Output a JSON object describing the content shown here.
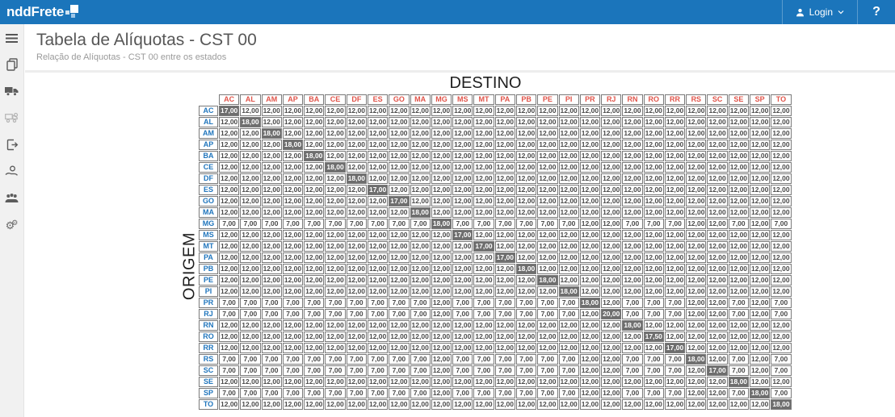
{
  "topbar": {
    "brand": "nddFrete",
    "login_label": "Login",
    "help_label": "?",
    "bg_color": "#1b75bb"
  },
  "sidebar": {
    "items": [
      {
        "icon": "menu-icon"
      },
      {
        "icon": "documents-icon"
      },
      {
        "icon": "truck-icon"
      },
      {
        "icon": "truck-search-icon"
      },
      {
        "icon": "export-icon"
      },
      {
        "icon": "payment-hand-icon"
      },
      {
        "icon": "users-icon"
      },
      {
        "icon": "settings-gears-icon"
      }
    ]
  },
  "page": {
    "title": "Tabela de Alíquotas - CST 00",
    "subtitle": "Relação de Alíquotas - CST 00 entre os estados"
  },
  "matrix": {
    "destino_label": "DESTINO",
    "origem_label": "ORIGEM",
    "diagonal_bg": "#6e6e6e",
    "col_header_color": "#e0544a",
    "row_header_color": "#2176bd",
    "states": [
      "AC",
      "AL",
      "AM",
      "AP",
      "BA",
      "CE",
      "DF",
      "ES",
      "GO",
      "MA",
      "MG",
      "MS",
      "MT",
      "PA",
      "PB",
      "PE",
      "PI",
      "PR",
      "RJ",
      "RN",
      "RO",
      "RR",
      "RS",
      "SC",
      "SE",
      "SP",
      "TO"
    ],
    "rows": [
      {
        "origin": "AC",
        "values": [
          "17,00",
          "12,00",
          "12,00",
          "12,00",
          "12,00",
          "12,00",
          "12,00",
          "12,00",
          "12,00",
          "12,00",
          "12,00",
          "12,00",
          "12,00",
          "12,00",
          "12,00",
          "12,00",
          "12,00",
          "12,00",
          "12,00",
          "12,00",
          "12,00",
          "12,00",
          "12,00",
          "12,00",
          "12,00",
          "12,00",
          "12,00"
        ]
      },
      {
        "origin": "AL",
        "values": [
          "12,00",
          "18,00",
          "12,00",
          "12,00",
          "12,00",
          "12,00",
          "12,00",
          "12,00",
          "12,00",
          "12,00",
          "12,00",
          "12,00",
          "12,00",
          "12,00",
          "12,00",
          "12,00",
          "12,00",
          "12,00",
          "12,00",
          "12,00",
          "12,00",
          "12,00",
          "12,00",
          "12,00",
          "12,00",
          "12,00",
          "12,00"
        ]
      },
      {
        "origin": "AM",
        "values": [
          "12,00",
          "12,00",
          "18,00",
          "12,00",
          "12,00",
          "12,00",
          "12,00",
          "12,00",
          "12,00",
          "12,00",
          "12,00",
          "12,00",
          "12,00",
          "12,00",
          "12,00",
          "12,00",
          "12,00",
          "12,00",
          "12,00",
          "12,00",
          "12,00",
          "12,00",
          "12,00",
          "12,00",
          "12,00",
          "12,00",
          "12,00"
        ]
      },
      {
        "origin": "AP",
        "values": [
          "12,00",
          "12,00",
          "12,00",
          "18,00",
          "12,00",
          "12,00",
          "12,00",
          "12,00",
          "12,00",
          "12,00",
          "12,00",
          "12,00",
          "12,00",
          "12,00",
          "12,00",
          "12,00",
          "12,00",
          "12,00",
          "12,00",
          "12,00",
          "12,00",
          "12,00",
          "12,00",
          "12,00",
          "12,00",
          "12,00",
          "12,00"
        ]
      },
      {
        "origin": "BA",
        "values": [
          "12,00",
          "12,00",
          "12,00",
          "12,00",
          "18,00",
          "12,00",
          "12,00",
          "12,00",
          "12,00",
          "12,00",
          "12,00",
          "12,00",
          "12,00",
          "12,00",
          "12,00",
          "12,00",
          "12,00",
          "12,00",
          "12,00",
          "12,00",
          "12,00",
          "12,00",
          "12,00",
          "12,00",
          "12,00",
          "12,00",
          "12,00"
        ]
      },
      {
        "origin": "CE",
        "values": [
          "12,00",
          "12,00",
          "12,00",
          "12,00",
          "12,00",
          "18,00",
          "12,00",
          "12,00",
          "12,00",
          "12,00",
          "12,00",
          "12,00",
          "12,00",
          "12,00",
          "12,00",
          "12,00",
          "12,00",
          "12,00",
          "12,00",
          "12,00",
          "12,00",
          "12,00",
          "12,00",
          "12,00",
          "12,00",
          "12,00",
          "12,00"
        ]
      },
      {
        "origin": "DF",
        "values": [
          "12,00",
          "12,00",
          "12,00",
          "12,00",
          "12,00",
          "12,00",
          "18,00",
          "12,00",
          "12,00",
          "12,00",
          "12,00",
          "12,00",
          "12,00",
          "12,00",
          "12,00",
          "12,00",
          "12,00",
          "12,00",
          "12,00",
          "12,00",
          "12,00",
          "12,00",
          "12,00",
          "12,00",
          "12,00",
          "12,00",
          "12,00"
        ]
      },
      {
        "origin": "ES",
        "values": [
          "12,00",
          "12,00",
          "12,00",
          "12,00",
          "12,00",
          "12,00",
          "12,00",
          "17,00",
          "12,00",
          "12,00",
          "12,00",
          "12,00",
          "12,00",
          "12,00",
          "12,00",
          "12,00",
          "12,00",
          "12,00",
          "12,00",
          "12,00",
          "12,00",
          "12,00",
          "12,00",
          "12,00",
          "12,00",
          "12,00",
          "12,00"
        ]
      },
      {
        "origin": "GO",
        "values": [
          "12,00",
          "12,00",
          "12,00",
          "12,00",
          "12,00",
          "12,00",
          "12,00",
          "12,00",
          "17,00",
          "12,00",
          "12,00",
          "12,00",
          "12,00",
          "12,00",
          "12,00",
          "12,00",
          "12,00",
          "12,00",
          "12,00",
          "12,00",
          "12,00",
          "12,00",
          "12,00",
          "12,00",
          "12,00",
          "12,00",
          "12,00"
        ]
      },
      {
        "origin": "MA",
        "values": [
          "12,00",
          "12,00",
          "12,00",
          "12,00",
          "12,00",
          "12,00",
          "12,00",
          "12,00",
          "12,00",
          "18,00",
          "12,00",
          "12,00",
          "12,00",
          "12,00",
          "12,00",
          "12,00",
          "12,00",
          "12,00",
          "12,00",
          "12,00",
          "12,00",
          "12,00",
          "12,00",
          "12,00",
          "12,00",
          "12,00",
          "12,00"
        ]
      },
      {
        "origin": "MG",
        "values": [
          "7,00",
          "7,00",
          "7,00",
          "7,00",
          "7,00",
          "7,00",
          "7,00",
          "7,00",
          "7,00",
          "7,00",
          "18,00",
          "7,00",
          "7,00",
          "7,00",
          "7,00",
          "7,00",
          "7,00",
          "12,00",
          "12,00",
          "7,00",
          "7,00",
          "7,00",
          "12,00",
          "12,00",
          "7,00",
          "12,00",
          "7,00"
        ]
      },
      {
        "origin": "MS",
        "values": [
          "12,00",
          "12,00",
          "12,00",
          "12,00",
          "12,00",
          "12,00",
          "12,00",
          "12,00",
          "12,00",
          "12,00",
          "12,00",
          "17,00",
          "12,00",
          "12,00",
          "12,00",
          "12,00",
          "12,00",
          "12,00",
          "12,00",
          "12,00",
          "12,00",
          "12,00",
          "12,00",
          "12,00",
          "12,00",
          "12,00",
          "12,00"
        ]
      },
      {
        "origin": "MT",
        "values": [
          "12,00",
          "12,00",
          "12,00",
          "12,00",
          "12,00",
          "12,00",
          "12,00",
          "12,00",
          "12,00",
          "12,00",
          "12,00",
          "12,00",
          "17,00",
          "12,00",
          "12,00",
          "12,00",
          "12,00",
          "12,00",
          "12,00",
          "12,00",
          "12,00",
          "12,00",
          "12,00",
          "12,00",
          "12,00",
          "12,00",
          "12,00"
        ]
      },
      {
        "origin": "PA",
        "values": [
          "12,00",
          "12,00",
          "12,00",
          "12,00",
          "12,00",
          "12,00",
          "12,00",
          "12,00",
          "12,00",
          "12,00",
          "12,00",
          "12,00",
          "12,00",
          "17,00",
          "12,00",
          "12,00",
          "12,00",
          "12,00",
          "12,00",
          "12,00",
          "12,00",
          "12,00",
          "12,00",
          "12,00",
          "12,00",
          "12,00",
          "12,00"
        ]
      },
      {
        "origin": "PB",
        "values": [
          "12,00",
          "12,00",
          "12,00",
          "12,00",
          "12,00",
          "12,00",
          "12,00",
          "12,00",
          "12,00",
          "12,00",
          "12,00",
          "12,00",
          "12,00",
          "12,00",
          "18,00",
          "12,00",
          "12,00",
          "12,00",
          "12,00",
          "12,00",
          "12,00",
          "12,00",
          "12,00",
          "12,00",
          "12,00",
          "12,00",
          "12,00"
        ]
      },
      {
        "origin": "PE",
        "values": [
          "12,00",
          "12,00",
          "12,00",
          "12,00",
          "12,00",
          "12,00",
          "12,00",
          "12,00",
          "12,00",
          "12,00",
          "12,00",
          "12,00",
          "12,00",
          "12,00",
          "12,00",
          "18,00",
          "12,00",
          "12,00",
          "12,00",
          "12,00",
          "12,00",
          "12,00",
          "12,00",
          "12,00",
          "12,00",
          "12,00",
          "12,00"
        ]
      },
      {
        "origin": "PI",
        "values": [
          "12,00",
          "12,00",
          "12,00",
          "12,00",
          "12,00",
          "12,00",
          "12,00",
          "12,00",
          "12,00",
          "12,00",
          "12,00",
          "12,00",
          "12,00",
          "12,00",
          "12,00",
          "12,00",
          "18,00",
          "12,00",
          "12,00",
          "12,00",
          "12,00",
          "12,00",
          "12,00",
          "12,00",
          "12,00",
          "12,00",
          "12,00"
        ]
      },
      {
        "origin": "PR",
        "values": [
          "7,00",
          "7,00",
          "7,00",
          "7,00",
          "7,00",
          "7,00",
          "7,00",
          "7,00",
          "7,00",
          "7,00",
          "12,00",
          "7,00",
          "7,00",
          "7,00",
          "7,00",
          "7,00",
          "7,00",
          "18,00",
          "12,00",
          "7,00",
          "7,00",
          "7,00",
          "12,00",
          "12,00",
          "7,00",
          "12,00",
          "7,00"
        ]
      },
      {
        "origin": "RJ",
        "values": [
          "7,00",
          "7,00",
          "7,00",
          "7,00",
          "7,00",
          "7,00",
          "7,00",
          "7,00",
          "7,00",
          "7,00",
          "12,00",
          "7,00",
          "7,00",
          "7,00",
          "7,00",
          "7,00",
          "7,00",
          "12,00",
          "20,00",
          "7,00",
          "7,00",
          "7,00",
          "12,00",
          "12,00",
          "7,00",
          "12,00",
          "7,00"
        ]
      },
      {
        "origin": "RN",
        "values": [
          "12,00",
          "12,00",
          "12,00",
          "12,00",
          "12,00",
          "12,00",
          "12,00",
          "12,00",
          "12,00",
          "12,00",
          "12,00",
          "12,00",
          "12,00",
          "12,00",
          "12,00",
          "12,00",
          "12,00",
          "12,00",
          "12,00",
          "18,00",
          "12,00",
          "12,00",
          "12,00",
          "12,00",
          "12,00",
          "12,00",
          "12,00"
        ]
      },
      {
        "origin": "RO",
        "values": [
          "12,00",
          "12,00",
          "12,00",
          "12,00",
          "12,00",
          "12,00",
          "12,00",
          "12,00",
          "12,00",
          "12,00",
          "12,00",
          "12,00",
          "12,00",
          "12,00",
          "12,00",
          "12,00",
          "12,00",
          "12,00",
          "12,00",
          "12,00",
          "17,50",
          "12,00",
          "12,00",
          "12,00",
          "12,00",
          "12,00",
          "12,00"
        ]
      },
      {
        "origin": "RR",
        "values": [
          "12,00",
          "12,00",
          "12,00",
          "12,00",
          "12,00",
          "12,00",
          "12,00",
          "12,00",
          "12,00",
          "12,00",
          "12,00",
          "12,00",
          "12,00",
          "12,00",
          "12,00",
          "12,00",
          "12,00",
          "12,00",
          "12,00",
          "12,00",
          "12,00",
          "17,00",
          "12,00",
          "12,00",
          "12,00",
          "12,00",
          "12,00"
        ]
      },
      {
        "origin": "RS",
        "values": [
          "7,00",
          "7,00",
          "7,00",
          "7,00",
          "7,00",
          "7,00",
          "7,00",
          "7,00",
          "7,00",
          "7,00",
          "12,00",
          "7,00",
          "7,00",
          "7,00",
          "7,00",
          "7,00",
          "7,00",
          "12,00",
          "12,00",
          "7,00",
          "7,00",
          "7,00",
          "18,00",
          "12,00",
          "7,00",
          "12,00",
          "7,00"
        ]
      },
      {
        "origin": "SC",
        "values": [
          "7,00",
          "7,00",
          "7,00",
          "7,00",
          "7,00",
          "7,00",
          "7,00",
          "7,00",
          "7,00",
          "7,00",
          "12,00",
          "7,00",
          "7,00",
          "7,00",
          "7,00",
          "7,00",
          "7,00",
          "12,00",
          "12,00",
          "7,00",
          "7,00",
          "7,00",
          "12,00",
          "17,00",
          "7,00",
          "12,00",
          "7,00"
        ]
      },
      {
        "origin": "SE",
        "values": [
          "12,00",
          "12,00",
          "12,00",
          "12,00",
          "12,00",
          "12,00",
          "12,00",
          "12,00",
          "12,00",
          "12,00",
          "12,00",
          "12,00",
          "12,00",
          "12,00",
          "12,00",
          "12,00",
          "12,00",
          "12,00",
          "12,00",
          "12,00",
          "12,00",
          "12,00",
          "12,00",
          "12,00",
          "18,00",
          "12,00",
          "12,00"
        ]
      },
      {
        "origin": "SP",
        "values": [
          "7,00",
          "7,00",
          "7,00",
          "7,00",
          "7,00",
          "7,00",
          "7,00",
          "7,00",
          "7,00",
          "7,00",
          "12,00",
          "7,00",
          "7,00",
          "7,00",
          "7,00",
          "7,00",
          "7,00",
          "12,00",
          "12,00",
          "7,00",
          "7,00",
          "7,00",
          "12,00",
          "12,00",
          "7,00",
          "18,00",
          "7,00"
        ]
      },
      {
        "origin": "TO",
        "values": [
          "12,00",
          "12,00",
          "12,00",
          "12,00",
          "12,00",
          "12,00",
          "12,00",
          "12,00",
          "12,00",
          "12,00",
          "12,00",
          "12,00",
          "12,00",
          "12,00",
          "12,00",
          "12,00",
          "12,00",
          "12,00",
          "12,00",
          "12,00",
          "12,00",
          "12,00",
          "12,00",
          "12,00",
          "12,00",
          "12,00",
          "18,00"
        ]
      }
    ]
  }
}
